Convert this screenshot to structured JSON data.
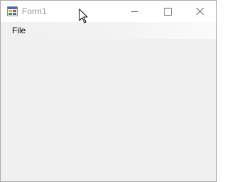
{
  "window": {
    "title": "Form1",
    "icon": "winforms-app-icon",
    "caption_buttons": [
      "minimize-icon",
      "maximize-icon",
      "close-icon"
    ]
  },
  "menu": {
    "items": [
      {
        "label": "File"
      }
    ]
  },
  "colors": {
    "titlebar_bg": "#ffffff",
    "title_text": "#999999",
    "client_bg": "#f0f0f0",
    "border": "#aaaaaa"
  },
  "cursor": "arrow-pointer-icon"
}
